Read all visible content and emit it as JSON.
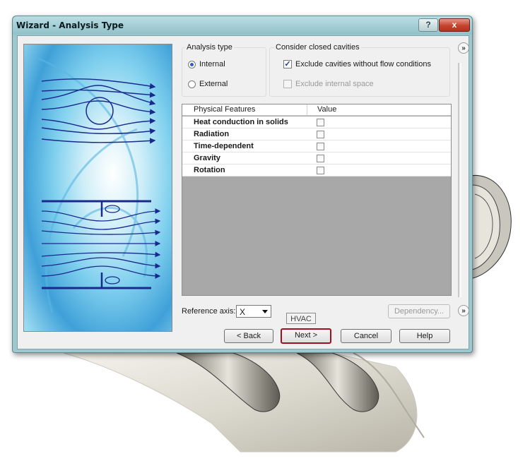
{
  "window": {
    "title": "Wizard - Analysis Type",
    "help_glyph": "?",
    "close_glyph": "x"
  },
  "analysis_type": {
    "label": "Analysis type",
    "options": [
      "Internal",
      "External"
    ],
    "selected": "Internal"
  },
  "closed_cavities": {
    "label": "Consider closed cavities",
    "exclude_without_flow": {
      "label": "Exclude cavities without flow conditions",
      "checked": true,
      "enabled": true
    },
    "exclude_internal_space": {
      "label": "Exclude internal space",
      "checked": false,
      "enabled": false
    }
  },
  "features_table": {
    "headers": [
      "Physical Features",
      "Value"
    ],
    "rows": [
      {
        "name": "Heat conduction in solids",
        "checked": false
      },
      {
        "name": "Radiation",
        "checked": false
      },
      {
        "name": "Time-dependent",
        "checked": false
      },
      {
        "name": "Gravity",
        "checked": false
      },
      {
        "name": "Rotation",
        "checked": false
      }
    ]
  },
  "reference_axis": {
    "label": "Reference axis:",
    "value": "X"
  },
  "buttons": {
    "dependency": "Dependency...",
    "back": "< Back",
    "next": "Next >",
    "cancel": "Cancel",
    "help": "Help",
    "expand": "»"
  },
  "tooltip": "HVAC",
  "colors": {
    "title_bar": "#9ec8cf",
    "close_button": "#c5432e",
    "focus_border": "#a01020",
    "flow_lines": "#1a2a8c"
  }
}
